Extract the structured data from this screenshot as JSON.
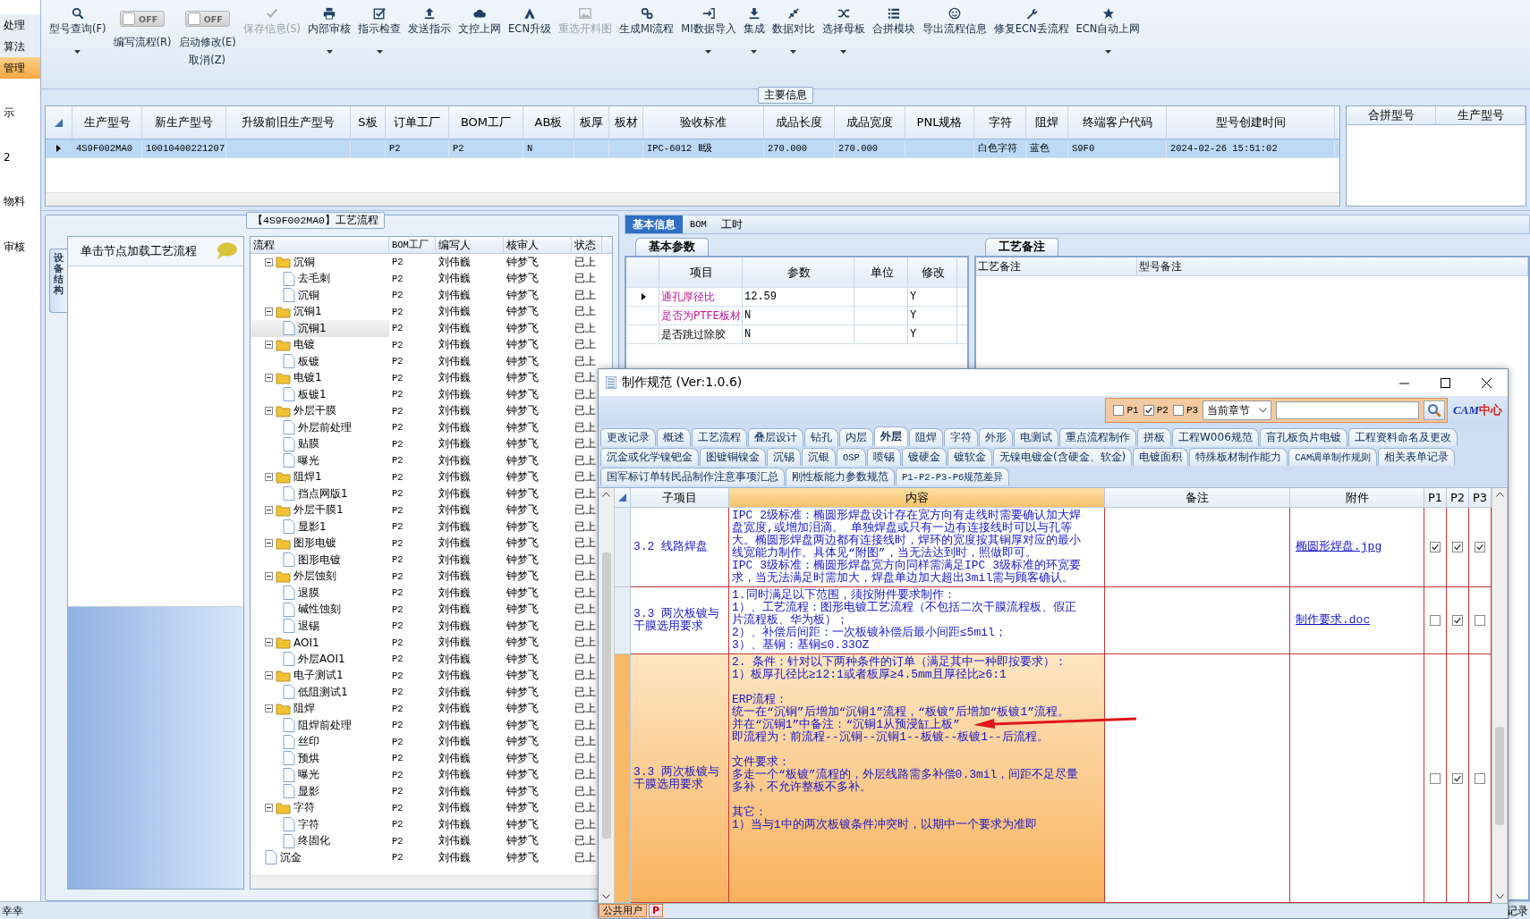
{
  "left_nav": {
    "items": [
      {
        "label": "处理",
        "selected": false
      },
      {
        "label": "算法",
        "selected": false
      },
      {
        "label": "管理",
        "selected": true
      }
    ],
    "labels": [
      "示",
      "2",
      "物料",
      "审核"
    ]
  },
  "toolbar": [
    {
      "kind": "button",
      "label": "型号查询(F)",
      "menu": true,
      "disabled": false
    },
    {
      "kind": "toggle",
      "label": "编写流程(R)",
      "state_text": "OFF",
      "on": false
    },
    {
      "kind": "toggle",
      "label": "启动修改(E)",
      "state_text": "OFF",
      "on": false,
      "sub_label": "取消(Z)"
    },
    {
      "kind": "button",
      "label": "保存信息(S)",
      "menu": false,
      "disabled": true
    },
    {
      "kind": "button",
      "label": "内部审核",
      "menu": true,
      "disabled": false
    },
    {
      "kind": "button",
      "label": "指示检查",
      "menu": true,
      "disabled": false
    },
    {
      "kind": "button",
      "label": "发送指示",
      "menu": false,
      "disabled": false
    },
    {
      "kind": "button",
      "label": "文控上网",
      "menu": false,
      "disabled": false
    },
    {
      "kind": "button",
      "label": "ECN升级",
      "menu": false,
      "disabled": false
    },
    {
      "kind": "button",
      "label": "重选开料图",
      "menu": false,
      "disabled": true
    },
    {
      "kind": "button",
      "label": "生成MI流程",
      "menu": false,
      "disabled": false
    },
    {
      "kind": "button",
      "label": "MI数据导入",
      "menu": true,
      "disabled": false
    },
    {
      "kind": "button",
      "label": "集成",
      "menu": true,
      "disabled": false
    },
    {
      "kind": "button",
      "label": "数据对比",
      "menu": true,
      "disabled": false
    },
    {
      "kind": "button",
      "label": "选择母板",
      "menu": true,
      "disabled": false
    },
    {
      "kind": "button",
      "label": "合拼模块",
      "menu": false,
      "disabled": false
    },
    {
      "kind": "button",
      "label": "导出流程信息",
      "menu": false,
      "disabled": false
    },
    {
      "kind": "button",
      "label": "修复ECN丢流程",
      "menu": false,
      "disabled": false
    },
    {
      "kind": "button",
      "label": "ECN自动上网",
      "menu": true,
      "disabled": false
    }
  ],
  "main_info": {
    "title": "主要信息",
    "columns": [
      "生产型号",
      "新生产型号",
      "升级前旧生产型号",
      "S板",
      "订单工厂",
      "BOM工厂",
      "AB板",
      "板厚",
      "板材",
      "验收标准",
      "成品长度",
      "成品宽度",
      "PNL规格",
      "字符",
      "阻焊",
      "终端客户代码",
      "型号创建时间"
    ],
    "rows": [
      {
        "selected": true,
        "cells": [
          "4S9F002MA0",
          "10010400221207",
          null,
          null,
          "P2",
          "P2",
          "N",
          null,
          null,
          "IPC-6012 Ⅱ级",
          "270.000",
          "270.000",
          null,
          "白色字符",
          "蓝色",
          "S9F0",
          "2024-02-26 15:51:02"
        ]
      }
    ],
    "merge_columns": [
      "合拼型号",
      "生产型号"
    ]
  },
  "process_flow": {
    "title": "【4S9F002MA0】工艺流程",
    "side_tab": "设备结构",
    "hint": "单击节点加载工艺流程",
    "columns": [
      "流程",
      "BOM工厂",
      "编写人",
      "核审人",
      "状态"
    ],
    "rows": [
      {
        "label": "沉铜",
        "bom": "P2",
        "writer": "刘伟巍",
        "reviewer": "钟梦飞",
        "status": "已上",
        "selected": false,
        "expanded": true,
        "children": [
          {
            "label": "去毛刺",
            "bom": "P2",
            "writer": "刘伟巍",
            "reviewer": "钟梦飞",
            "status": "已上",
            "selected": false
          },
          {
            "label": "沉铜",
            "bom": "P2",
            "writer": "刘伟巍",
            "reviewer": "钟梦飞",
            "status": "已上",
            "selected": false
          }
        ]
      },
      {
        "label": "沉铜1",
        "bom": "P2",
        "writer": "刘伟巍",
        "reviewer": "钟梦飞",
        "status": "已上",
        "selected": false,
        "expanded": true,
        "children": [
          {
            "label": "沉铜1",
            "bom": "P2",
            "writer": "刘伟巍",
            "reviewer": "钟梦飞",
            "status": "已上",
            "selected": true
          }
        ]
      },
      {
        "label": "电镀",
        "bom": "P2",
        "writer": "刘伟巍",
        "reviewer": "钟梦飞",
        "status": "已上",
        "selected": false,
        "expanded": true,
        "children": [
          {
            "label": "板镀",
            "bom": "P2",
            "writer": "刘伟巍",
            "reviewer": "钟梦飞",
            "status": "已上",
            "selected": false
          }
        ]
      },
      {
        "label": "电镀1",
        "bom": "P2",
        "writer": "刘伟巍",
        "reviewer": "钟梦飞",
        "status": "已上",
        "selected": false,
        "expanded": true,
        "children": [
          {
            "label": "板镀1",
            "bom": "P2",
            "writer": "刘伟巍",
            "reviewer": "钟梦飞",
            "status": "已上",
            "selected": false
          }
        ]
      },
      {
        "label": "外层干膜",
        "bom": "P2",
        "writer": "刘伟巍",
        "reviewer": "钟梦飞",
        "status": "已上",
        "selected": false,
        "expanded": true,
        "children": [
          {
            "label": "外层前处理",
            "bom": "P2",
            "writer": "刘伟巍",
            "reviewer": "钟梦飞",
            "status": "已上",
            "selected": false
          },
          {
            "label": "贴膜",
            "bom": "P2",
            "writer": "刘伟巍",
            "reviewer": "钟梦飞",
            "status": "已上",
            "selected": false
          },
          {
            "label": "曝光",
            "bom": "P2",
            "writer": "刘伟巍",
            "reviewer": "钟梦飞",
            "status": "已上",
            "selected": false
          }
        ]
      },
      {
        "label": "阻焊1",
        "bom": "P2",
        "writer": "刘伟巍",
        "reviewer": "钟梦飞",
        "status": "已上",
        "selected": false,
        "expanded": true,
        "children": [
          {
            "label": "挡点网版1",
            "bom": "P2",
            "writer": "刘伟巍",
            "reviewer": "钟梦飞",
            "status": "已上",
            "selected": false
          }
        ]
      },
      {
        "label": "外层干膜1",
        "bom": "P2",
        "writer": "刘伟巍",
        "reviewer": "钟梦飞",
        "status": "已上",
        "selected": false,
        "expanded": true,
        "children": [
          {
            "label": "显影1",
            "bom": "P2",
            "writer": "刘伟巍",
            "reviewer": "钟梦飞",
            "status": "已上",
            "selected": false
          }
        ]
      },
      {
        "label": "图形电镀",
        "bom": "P2",
        "writer": "刘伟巍",
        "reviewer": "钟梦飞",
        "status": "已上",
        "selected": false,
        "expanded": true,
        "children": [
          {
            "label": "图形电镀",
            "bom": "P2",
            "writer": "刘伟巍",
            "reviewer": "钟梦飞",
            "status": "已上",
            "selected": false
          }
        ]
      },
      {
        "label": "外层蚀刻",
        "bom": "P2",
        "writer": "刘伟巍",
        "reviewer": "钟梦飞",
        "status": "已上",
        "selected": false,
        "expanded": true,
        "children": [
          {
            "label": "退膜",
            "bom": "P2",
            "writer": "刘伟巍",
            "reviewer": "钟梦飞",
            "status": "已上",
            "selected": false
          },
          {
            "label": "碱性蚀刻",
            "bom": "P2",
            "writer": "刘伟巍",
            "reviewer": "钟梦飞",
            "status": "已上",
            "selected": false
          },
          {
            "label": "退锡",
            "bom": "P2",
            "writer": "刘伟巍",
            "reviewer": "钟梦飞",
            "status": "已上",
            "selected": false
          }
        ]
      },
      {
        "label": "AOI1",
        "bom": "P2",
        "writer": "刘伟巍",
        "reviewer": "钟梦飞",
        "status": "已上",
        "selected": false,
        "expanded": true,
        "children": [
          {
            "label": "外层AOI1",
            "bom": "P2",
            "writer": "刘伟巍",
            "reviewer": "钟梦飞",
            "status": "已上",
            "selected": false
          }
        ]
      },
      {
        "label": "电子测试1",
        "bom": "P2",
        "writer": "刘伟巍",
        "reviewer": "钟梦飞",
        "status": "已上",
        "selected": false,
        "expanded": true,
        "children": [
          {
            "label": "低阻测试1",
            "bom": "P2",
            "writer": "刘伟巍",
            "reviewer": "钟梦飞",
            "status": "已上",
            "selected": false
          }
        ]
      },
      {
        "label": "阻焊",
        "bom": "P2",
        "writer": "刘伟巍",
        "reviewer": "钟梦飞",
        "status": "已上",
        "selected": false,
        "expanded": true,
        "children": [
          {
            "label": "阻焊前处理",
            "bom": "P2",
            "writer": "刘伟巍",
            "reviewer": "钟梦飞",
            "status": "已上",
            "selected": false
          },
          {
            "label": "丝印",
            "bom": "P2",
            "writer": "刘伟巍",
            "reviewer": "钟梦飞",
            "status": "已上",
            "selected": false
          },
          {
            "label": "预烘",
            "bom": "P2",
            "writer": "刘伟巍",
            "reviewer": "钟梦飞",
            "status": "已上",
            "selected": false
          },
          {
            "label": "曝光",
            "bom": "P2",
            "writer": "刘伟巍",
            "reviewer": "钟梦飞",
            "status": "已上",
            "selected": false
          },
          {
            "label": "显影",
            "bom": "P2",
            "writer": "刘伟巍",
            "reviewer": "钟梦飞",
            "status": "已上",
            "selected": false
          }
        ]
      },
      {
        "label": "字符",
        "bom": "P2",
        "writer": "刘伟巍",
        "reviewer": "钟梦飞",
        "status": "已上",
        "selected": false,
        "expanded": true,
        "children": [
          {
            "label": "字符",
            "bom": "P2",
            "writer": "刘伟巍",
            "reviewer": "钟梦飞",
            "status": "已上",
            "selected": false
          },
          {
            "label": "终固化",
            "bom": "P2",
            "writer": "刘伟巍",
            "reviewer": "钟梦飞",
            "status": "已上",
            "selected": false
          }
        ]
      },
      {
        "label": "沉金",
        "bom": "P2",
        "writer": "刘伟巍",
        "reviewer": "钟梦飞",
        "status": "已上",
        "selected": false
      }
    ]
  },
  "detail": {
    "tabs": [
      {
        "label": "基本信息",
        "selected": true
      },
      {
        "label": "BOM",
        "selected": false
      },
      {
        "label": "工时",
        "selected": false
      }
    ],
    "params": {
      "tab": "基本参数",
      "columns": [
        "项目",
        "参数",
        "单位",
        "修改"
      ],
      "rows": [
        {
          "item": "通孔厚径比",
          "highlighted": true,
          "value": "12.59",
          "modify": "Y"
        },
        {
          "item": "是否为PTFE板材",
          "highlighted": true,
          "value": "N",
          "modify": "Y"
        },
        {
          "item": "是否跳过除胶",
          "highlighted": false,
          "value": "N",
          "modify": "Y"
        }
      ]
    },
    "notes": {
      "tab": "工艺备注",
      "columns": [
        "工艺备注",
        "型号备注"
      ]
    }
  },
  "dialog": {
    "title": "制作规范 (Ver:1.0.6)",
    "filters": [
      {
        "label": "P1",
        "checked": false
      },
      {
        "label": "P2",
        "checked": true
      },
      {
        "label": "P3",
        "checked": false
      }
    ],
    "scope": "当前章节",
    "logo": {
      "part_1": "CAM",
      "part_2": "中心"
    },
    "tab_rows": [
      [
        {
          "label": "更改记录",
          "selected": false
        },
        {
          "label": "概述",
          "selected": false
        },
        {
          "label": "工艺流程",
          "selected": false
        },
        {
          "label": "叠层设计",
          "selected": false
        },
        {
          "label": "钻孔",
          "selected": false
        },
        {
          "label": "内层",
          "selected": false
        },
        {
          "label": "外层",
          "selected": true
        },
        {
          "label": "阻焊",
          "selected": false
        },
        {
          "label": "字符",
          "selected": false
        },
        {
          "label": "外形",
          "selected": false
        },
        {
          "label": "电测试",
          "selected": false
        },
        {
          "label": "重点流程制作",
          "selected": false
        },
        {
          "label": "拼板",
          "selected": false
        },
        {
          "label": "工程W006规范",
          "selected": false
        },
        {
          "label": "盲孔板负片电镀",
          "selected": false
        },
        {
          "label": "工程资料命名及更改",
          "selected": false
        }
      ],
      [
        {
          "label": "沉金或化学镍钯金",
          "selected": false
        },
        {
          "label": "图镀铜镍金",
          "selected": false
        },
        {
          "label": "沉锡",
          "selected": false
        },
        {
          "label": "沉银",
          "selected": false
        },
        {
          "label": "OSP",
          "selected": false
        },
        {
          "label": "喷锡",
          "selected": false
        },
        {
          "label": "镀硬金",
          "selected": false
        },
        {
          "label": "镀软金",
          "selected": false
        },
        {
          "label": "无镍电镀金(含硬金、软金)",
          "selected": false
        },
        {
          "label": "电镀面积",
          "selected": false
        },
        {
          "label": "特殊板材制作能力",
          "selected": false
        },
        {
          "label": "CAM调单制作规则",
          "selected": false
        },
        {
          "label": "相关表单记录",
          "selected": false
        }
      ],
      [
        {
          "label": "国军标订单转民品制作注意事项汇总",
          "selected": false
        },
        {
          "label": "刚性板能力参数规范",
          "selected": false
        },
        {
          "label": "P1-P2-P3-P6规范差异",
          "selected": false
        }
      ]
    ],
    "columns": [
      "子项目",
      "内容",
      "备注",
      "附件",
      "P1",
      "P2",
      "P3"
    ],
    "rows": [
      {
        "selected": false,
        "sub_item": "3.2 线路焊盘",
        "content": [
          "IPC 2级标准：椭圆形焊盘设计存在宽方向有走线时需要确认加大焊盘宽度,或增加泪滴。 单独焊盘或只有一边有连接线时可以与孔等大。椭圆形焊盘两边都有连接线时，焊环的宽度按其铜厚对应的最小线宽能力制作。具体见“附图”，当无法达到时，照做即可。",
          "IPC 3级标准：椭圆形焊盘宽方向同样需满足IPC 3级标准的环宽要求，当无法满足时需加大，焊盘单边加大超出3mil需与顾客确认。"
        ],
        "attachment": "椭圆形焊盘.jpg",
        "p1": true,
        "p2": true,
        "p3": true
      },
      {
        "selected": false,
        "sub_item": "3.3 两次板镀与干膜选用要求",
        "content": [
          "1.同时满足以下范围，须按附件要求制作：",
          "1）、工艺流程：图形电镀工艺流程（不包括二次干膜流程板、假正片流程板、华为板）；",
          "2）、补偿后间距：一次板镀补偿后最小间距≤5mil；",
          "3）、基铜：基铜≤0.33OZ"
        ],
        "attachment": "制作要求.doc",
        "p1": false,
        "p2": true,
        "p3": false
      },
      {
        "selected": true,
        "sub_item": "3.3 两次板镀与干膜选用要求",
        "content": [
          "2. 条件：针对以下两种条件的订单（满足其中一种即按要求）：",
          "1）板厚孔径比≥12:1或者板厚≥4.5mm且厚径比≥6:1",
          "ERP流程：",
          "统一在“沉铜”后增加“沉铜1”流程，“板镀”后增加“板镀1”流程。",
          "并在“沉铜1”中备注：“沉铜1从预浸缸上板”",
          "即流程为：前流程--沉铜--沉铜1--板镀--板镀1--后流程。",
          "文件要求：",
          "多走一个“板镀”流程的，外层线路需多补偿0.3mil，间距不足尽量多补，不允许整板不多补。",
          "其它：",
          "1）当与1中的两次板镀条件冲突时，以期中一个要求为准即"
        ],
        "p1": false,
        "p2": true,
        "p3": false
      }
    ],
    "footer": {
      "user": "公共用户",
      "badge": "P"
    }
  },
  "status_bar": {
    "left": "幸幸",
    "right": "记录"
  }
}
